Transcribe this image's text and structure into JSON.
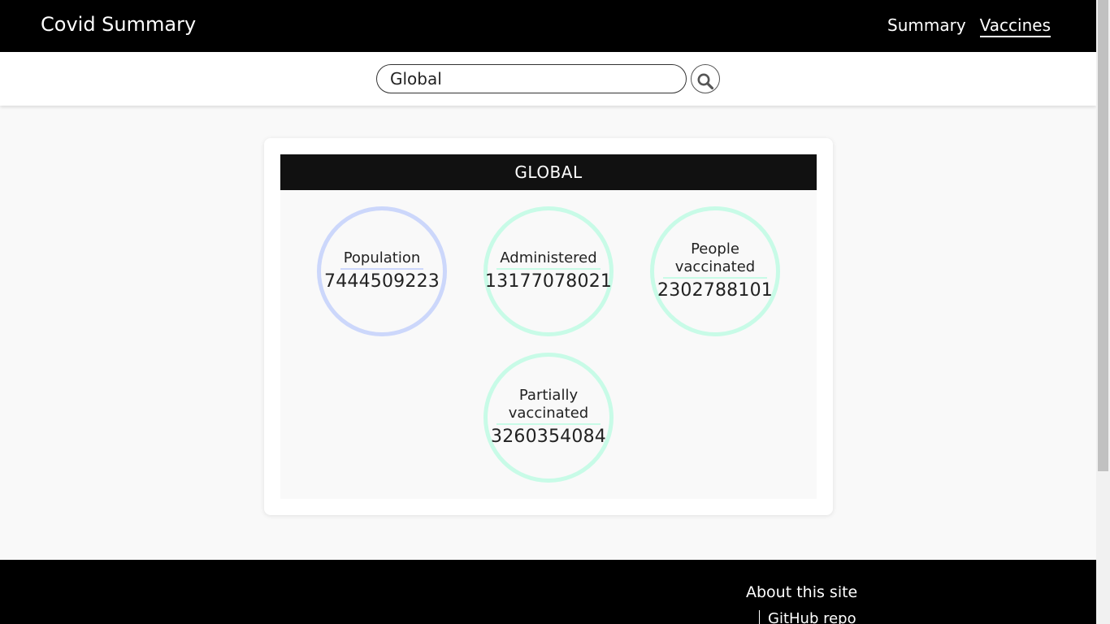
{
  "header": {
    "brand": "Covid Summary",
    "nav": [
      {
        "label": "Summary",
        "active": false
      },
      {
        "label": "Vaccines",
        "active": true
      }
    ]
  },
  "search": {
    "value": "Global",
    "icon": "search-icon"
  },
  "card": {
    "title": "GLOBAL",
    "stats": [
      {
        "label": "Population",
        "value": "7444509223",
        "color": "#ccd7fb"
      },
      {
        "label": "Administered",
        "value": "13177078021",
        "color": "#c8fbe7"
      },
      {
        "label": "People vaccinated",
        "value": "2302788101",
        "color": "#c8fbe7"
      },
      {
        "label": "Partially vaccinated",
        "value": "3260354084",
        "color": "#c8fbe7"
      }
    ]
  },
  "footer": {
    "title": "About this site",
    "link": "GitHub repo"
  },
  "colors": {
    "header_bg": "#000000",
    "page_bg": "#f9f9f9"
  }
}
